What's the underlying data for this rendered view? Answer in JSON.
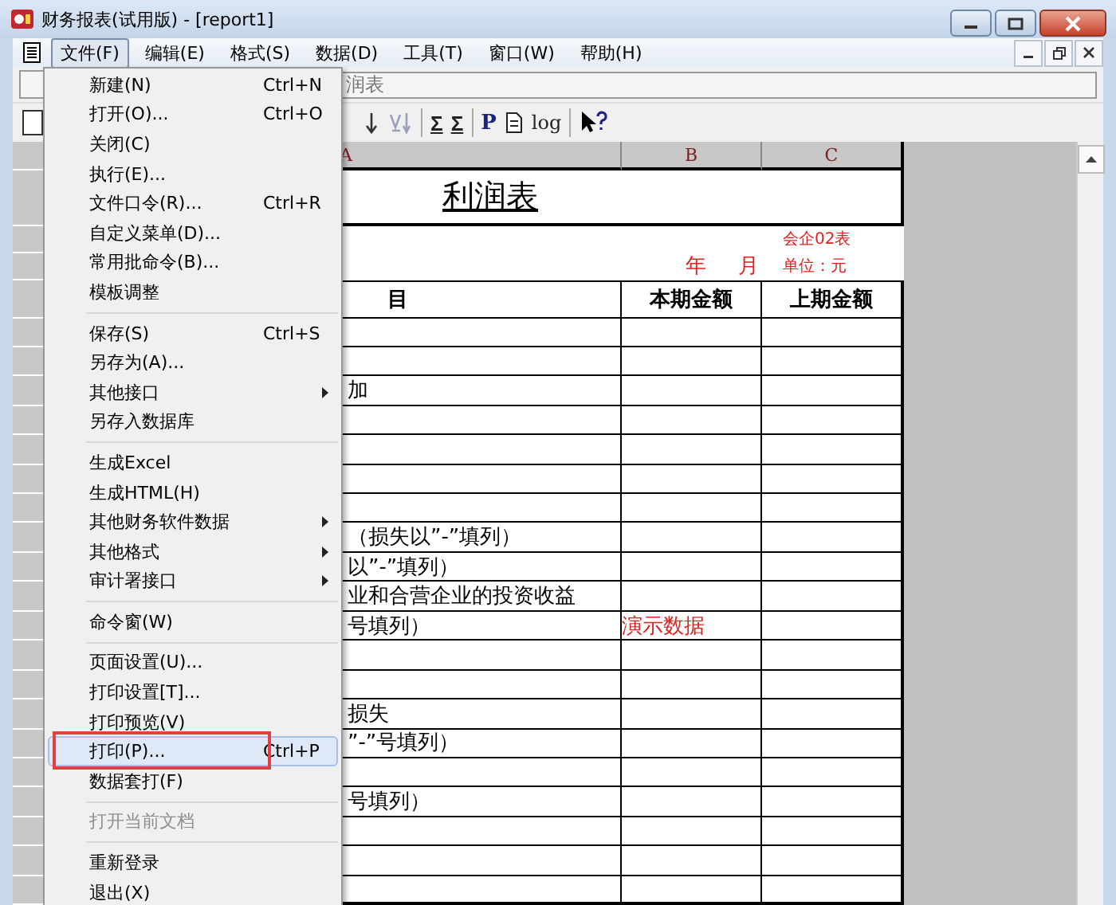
{
  "window": {
    "title": "财务报表(试用版) - [report1]"
  },
  "menubar": [
    {
      "label": "文件(F)",
      "selected": true
    },
    {
      "label": "编辑(E)",
      "selected": false
    },
    {
      "label": "格式(S)",
      "selected": false
    },
    {
      "label": "数据(D)",
      "selected": false
    },
    {
      "label": "工具(T)",
      "selected": false
    },
    {
      "label": "窗口(W)",
      "selected": false
    },
    {
      "label": "帮助(H)",
      "selected": false
    }
  ],
  "formula_bar": {
    "value": "润表"
  },
  "toolbar": {
    "text_buttons": [
      "Σ",
      "Σ",
      "P",
      "log"
    ]
  },
  "file_menu": [
    {
      "kind": "item",
      "label": "新建(N)",
      "shortcut": "Ctrl+N",
      "submenu": false,
      "disabled": false,
      "selected": false,
      "annotated": false
    },
    {
      "kind": "item",
      "label": "打开(O)...",
      "shortcut": "Ctrl+O",
      "submenu": false,
      "disabled": false,
      "selected": false,
      "annotated": false
    },
    {
      "kind": "item",
      "label": "关闭(C)",
      "submenu": false,
      "disabled": false,
      "selected": false,
      "annotated": false
    },
    {
      "kind": "item",
      "label": "执行(E)...",
      "submenu": false,
      "disabled": false,
      "selected": false,
      "annotated": false
    },
    {
      "kind": "item",
      "label": "文件口令(R)...",
      "shortcut": "Ctrl+R",
      "submenu": false,
      "disabled": false,
      "selected": false,
      "annotated": false
    },
    {
      "kind": "item",
      "label": "自定义菜单(D)...",
      "submenu": false,
      "disabled": false,
      "selected": false,
      "annotated": false
    },
    {
      "kind": "item",
      "label": "常用批命令(B)...",
      "submenu": false,
      "disabled": false,
      "selected": false,
      "annotated": false
    },
    {
      "kind": "item",
      "label": "模板调整",
      "submenu": false,
      "disabled": false,
      "selected": false,
      "annotated": false
    },
    {
      "kind": "separator"
    },
    {
      "kind": "item",
      "label": "保存(S)",
      "shortcut": "Ctrl+S",
      "submenu": false,
      "disabled": false,
      "selected": false,
      "annotated": false
    },
    {
      "kind": "item",
      "label": "另存为(A)...",
      "submenu": false,
      "disabled": false,
      "selected": false,
      "annotated": false
    },
    {
      "kind": "item",
      "label": "其他接口",
      "submenu": true,
      "disabled": false,
      "selected": false,
      "annotated": false
    },
    {
      "kind": "item",
      "label": "另存入数据库",
      "submenu": false,
      "disabled": false,
      "selected": false,
      "annotated": false
    },
    {
      "kind": "separator"
    },
    {
      "kind": "item",
      "label": "生成Excel",
      "submenu": false,
      "disabled": false,
      "selected": false,
      "annotated": false
    },
    {
      "kind": "item",
      "label": "生成HTML(H)",
      "submenu": false,
      "disabled": false,
      "selected": false,
      "annotated": false
    },
    {
      "kind": "item",
      "label": "其他财务软件数据",
      "submenu": true,
      "disabled": false,
      "selected": false,
      "annotated": false
    },
    {
      "kind": "item",
      "label": "其他格式",
      "submenu": true,
      "disabled": false,
      "selected": false,
      "annotated": false
    },
    {
      "kind": "item",
      "label": "审计署接口",
      "submenu": true,
      "disabled": false,
      "selected": false,
      "annotated": false
    },
    {
      "kind": "separator"
    },
    {
      "kind": "item",
      "label": "命令窗(W)",
      "submenu": false,
      "disabled": false,
      "selected": false,
      "annotated": false
    },
    {
      "kind": "separator"
    },
    {
      "kind": "item",
      "label": "页面设置(U)...",
      "submenu": false,
      "disabled": false,
      "selected": false,
      "annotated": false
    },
    {
      "kind": "item",
      "label": "打印设置[T]...",
      "submenu": false,
      "disabled": false,
      "selected": false,
      "annotated": false
    },
    {
      "kind": "item",
      "label": "打印预览(V)",
      "submenu": false,
      "disabled": false,
      "selected": false,
      "annotated": false
    },
    {
      "kind": "item",
      "label": "打印(P)...",
      "shortcut": "Ctrl+P",
      "submenu": false,
      "disabled": false,
      "selected": true,
      "annotated": true
    },
    {
      "kind": "item",
      "label": "数据套打(F)",
      "submenu": false,
      "disabled": false,
      "selected": false,
      "annotated": false
    },
    {
      "kind": "separator"
    },
    {
      "kind": "item",
      "label": "打开当前文档",
      "submenu": false,
      "disabled": true,
      "selected": false,
      "annotated": false
    },
    {
      "kind": "separator"
    },
    {
      "kind": "item",
      "label": "重新登录",
      "submenu": false,
      "disabled": false,
      "selected": false,
      "annotated": false
    },
    {
      "kind": "item",
      "label": "退出(X)",
      "submenu": false,
      "disabled": false,
      "selected": false,
      "annotated": false
    }
  ],
  "sheet": {
    "columns": [
      "A",
      "B",
      "C"
    ],
    "title": "利润表",
    "form_code": "会企02表",
    "period_year": "年",
    "period_month": "月",
    "unit": "单位：元",
    "header": [
      "目",
      "本期金额",
      "上期金额"
    ],
    "rows": [
      {},
      {},
      {
        "item": "加"
      },
      {},
      {},
      {},
      {},
      {
        "item": "（损失以”-”填列）"
      },
      {
        "item": "以”-”填列）"
      },
      {
        "item": "业和合营企业的投资收益"
      },
      {
        "item": "号填列）",
        "current": "演示数据"
      },
      {},
      {},
      {
        "item": "损失"
      },
      {
        "item": "”-”号填列）"
      },
      {},
      {
        "item": "号填列）"
      },
      {},
      {},
      {}
    ]
  }
}
